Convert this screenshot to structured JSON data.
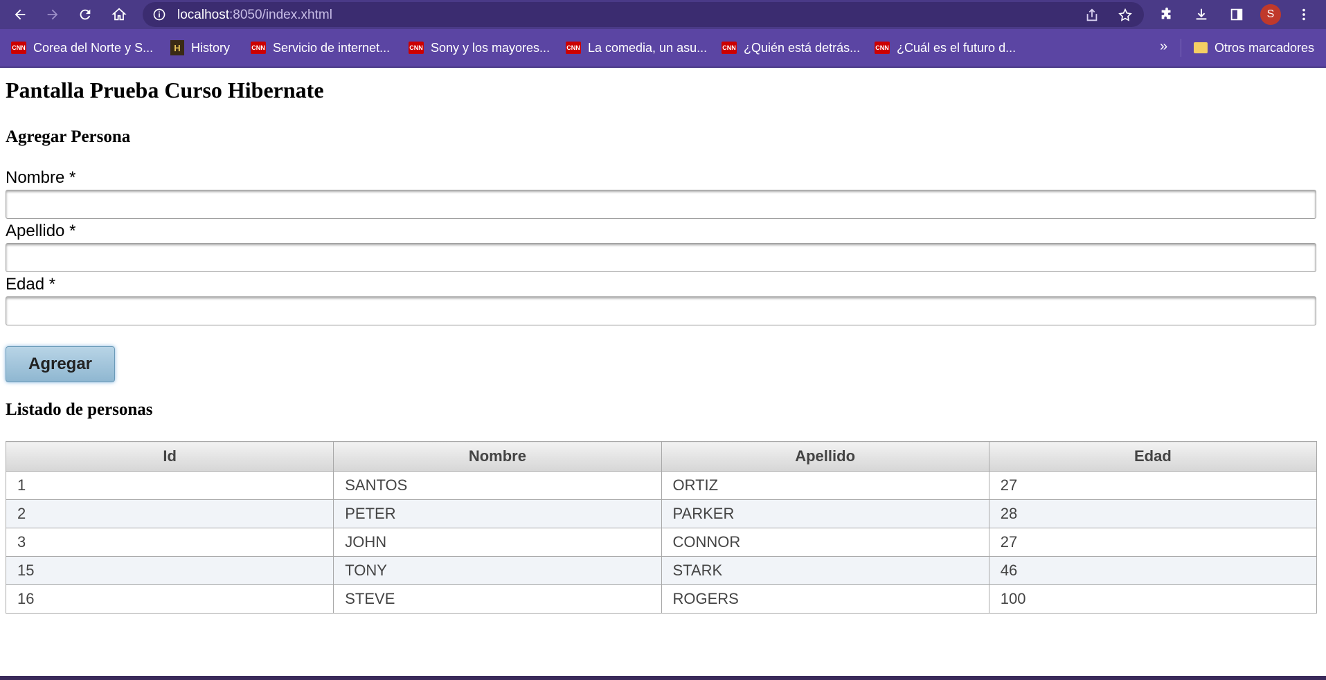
{
  "browser": {
    "url_host": "localhost",
    "url_path": ":8050/index.xhtml",
    "avatar_initial": "S",
    "bookmarks": [
      {
        "label": "Corea del Norte y S...",
        "icon": "cnn-icon"
      },
      {
        "label": "History",
        "icon": "history-icon"
      },
      {
        "label": "Servicio de internet...",
        "icon": "cnn-icon"
      },
      {
        "label": "Sony y los mayores...",
        "icon": "cnn-icon"
      },
      {
        "label": "La comedia, un asu...",
        "icon": "cnn-icon"
      },
      {
        "label": "¿Quién está detrás...",
        "icon": "cnn-icon"
      },
      {
        "label": "¿Cuál es el futuro d...",
        "icon": "cnn-icon"
      }
    ],
    "more_bookmarks": "»",
    "other_bookmarks": "Otros marcadores",
    "cnn_text": "CNN",
    "history_text": "H"
  },
  "page": {
    "title": "Pantalla Prueba Curso Hibernate",
    "form_heading": "Agregar Persona",
    "fields": {
      "nombre_label": "Nombre  *",
      "apellido_label": "Apellido  *",
      "edad_label": "Edad  *"
    },
    "add_button": "Agregar",
    "list_heading": "Listado de personas",
    "table": {
      "headers": [
        "Id",
        "Nombre",
        "Apellido",
        "Edad"
      ],
      "rows": [
        [
          "1",
          "SANTOS",
          "ORTIZ",
          "27"
        ],
        [
          "2",
          "PETER",
          "PARKER",
          "28"
        ],
        [
          "3",
          "JOHN",
          "CONNOR",
          "27"
        ],
        [
          "15",
          "TONY",
          "STARK",
          "46"
        ],
        [
          "16",
          "STEVE",
          "ROGERS",
          "100"
        ]
      ]
    }
  },
  "colors": {
    "toolbar": "#4a3a87",
    "bookmarks_bar": "#5b45a3",
    "button_accent": "#8fb7d1"
  }
}
